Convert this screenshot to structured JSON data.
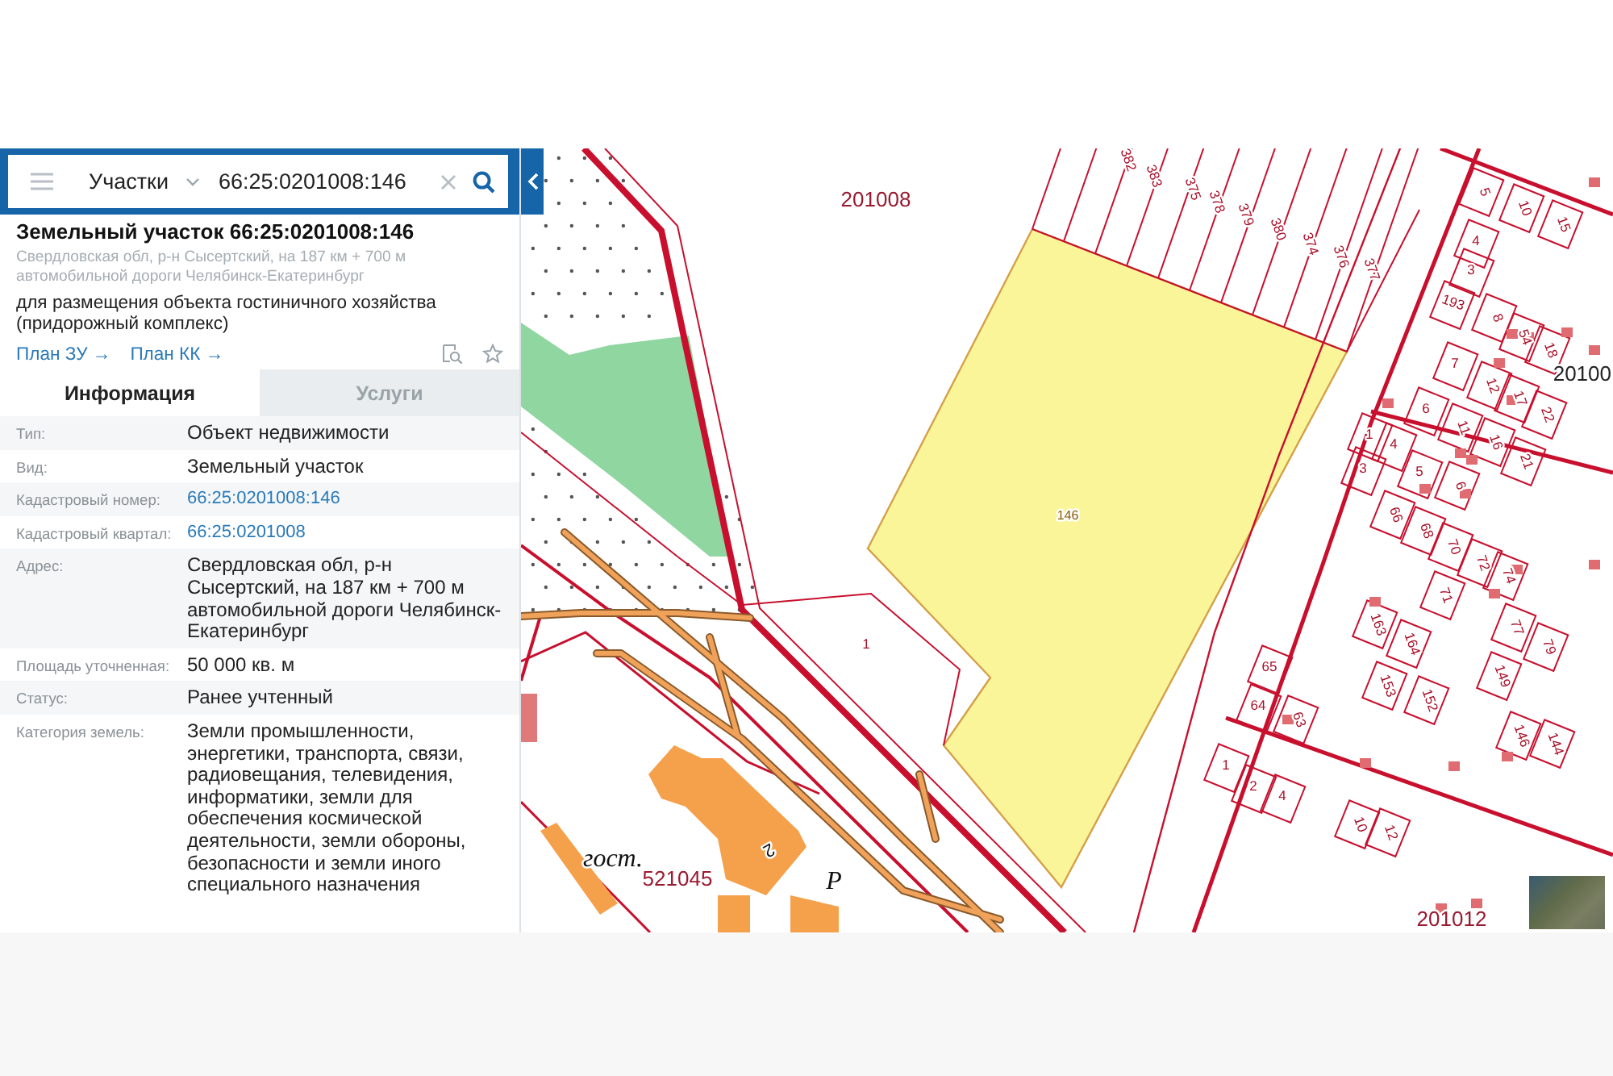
{
  "search": {
    "category": "Участки",
    "value": "66:25:0201008:146"
  },
  "parcel": {
    "title": "Земельный участок 66:25:0201008:146",
    "address": "Свердловская обл, р-н Сысертский, на 187 км + 700 м автомобильной дороги Челябинск-Екатеринбург",
    "purpose": "для размещения объекта гостиничного хозяйства (придорожный комплекс)",
    "links": [
      "План ЗУ →",
      "План КК →"
    ]
  },
  "tabs": [
    {
      "label": "Информация",
      "selected": true
    },
    {
      "label": "Услуги",
      "selected": false
    }
  ],
  "info_rows": [
    {
      "label": "Тип:",
      "value": "Объект недвижимости",
      "kind": "text"
    },
    {
      "label": "Вид:",
      "value": "Земельный участок",
      "kind": "text"
    },
    {
      "label": "Кадастровый номер:",
      "value": "66:25:0201008:146",
      "kind": "link"
    },
    {
      "label": "Кадастровый квартал:",
      "value": "66:25:0201008",
      "kind": "link"
    },
    {
      "label": "Адрес:",
      "value": "Свердловская обл, р-н Сысертский, на 187 км + 700 м автомобильной дороги Челябинск-Екатеринбург",
      "kind": "text"
    },
    {
      "label": "Площадь уточненная:",
      "value": "50 000 кв. м",
      "kind": "text"
    },
    {
      "label": "Статус:",
      "value": "Ранее учтенный",
      "kind": "text"
    },
    {
      "label": "Категория земель:",
      "value": "Земли промышленности, энергетики, транспорта, связи, радиовещания, телевидения, информатики, земли для обеспечения космической деятельности, земли обороны, безопасности и земли иного специального назначения",
      "kind": "text"
    }
  ],
  "map": {
    "labels": [
      "382",
      "383",
      "375",
      "5",
      "378",
      "201008",
      "10",
      "379",
      "15",
      "380",
      "374",
      "4",
      "376",
      "377",
      "3",
      "193",
      "8",
      "54",
      "18",
      "7",
      "20100",
      "12",
      "17",
      "6",
      "22",
      "11",
      "1",
      "16",
      "4",
      "21",
      "3",
      "5",
      "6",
      "66",
      "146",
      "68",
      "70",
      "72",
      "74",
      "71",
      "163",
      "77",
      "164",
      "1",
      "79",
      "65",
      "149",
      "153",
      "152",
      "64",
      "63",
      "146",
      "144",
      "1",
      "2",
      "4",
      "10",
      "12",
      "2",
      "гост.",
      "521045",
      "Р",
      "201012"
    ]
  }
}
